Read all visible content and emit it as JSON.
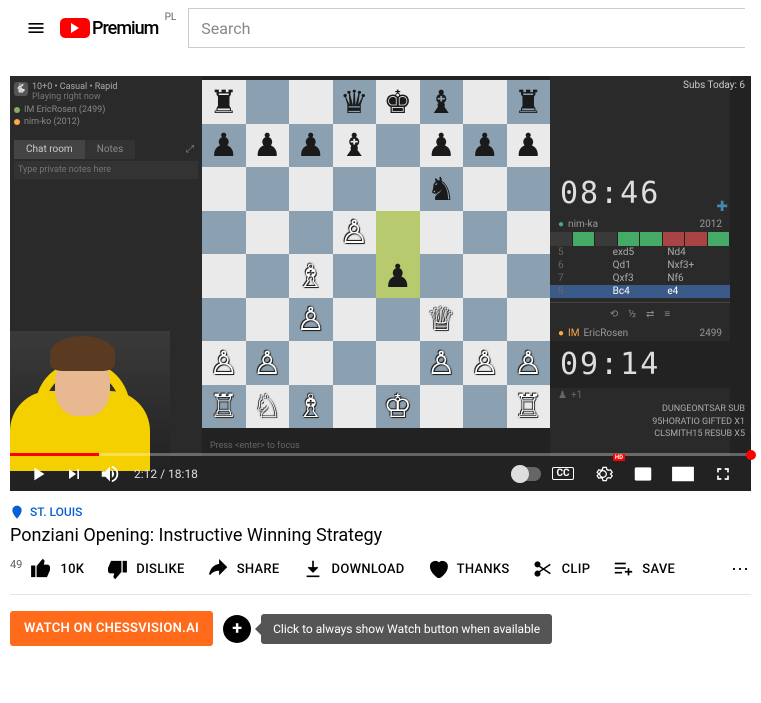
{
  "header": {
    "logo_text": "Premium",
    "country": "PL",
    "search_placeholder": "Search"
  },
  "video": {
    "subs_today": "Subs Today: 6",
    "game_mode": "10+0 • Casual • Rapid",
    "game_status": "Playing right now",
    "players": {
      "top": {
        "name": "IM EricRosen (2499)",
        "color": "#8a6"
      },
      "bottom": {
        "name": "nim-ko (2012)",
        "color": "#fa4"
      }
    },
    "tabs": {
      "chat": "Chat room",
      "notes": "Notes"
    },
    "notes_placeholder": "Type private notes here",
    "clock_top": "08:46",
    "clock_bottom": "09:14",
    "opponent": {
      "name": "nim-ka",
      "rating": "2012"
    },
    "self": {
      "title": "IM",
      "name": "EricRosen",
      "rating": "2499"
    },
    "moves": [
      {
        "n": "5",
        "w": "exd5",
        "b": "Nd4"
      },
      {
        "n": "6",
        "w": "Qd1",
        "b": "Nxf3+"
      },
      {
        "n": "7",
        "w": "Qxf3",
        "b": "Nf6"
      },
      {
        "n": "8",
        "w": "Bc4",
        "b": "e4",
        "cur": true
      }
    ],
    "nav": {
      "back": "½",
      "flip": "⇄"
    },
    "sub_events": [
      "DUNGEONTSAR  SUB",
      "95HORATIO  GIFTED X1",
      "CLSMITH15  RESUB X5"
    ],
    "time_current": "2:12",
    "time_total": "18:18",
    "press_enter": "Press <enter> to focus"
  },
  "meta": {
    "location": "ST. LOUIS",
    "title": "Ponziani Opening: Instructive Winning Strategy",
    "rank": "49",
    "like_count": "10K",
    "actions": {
      "dislike": "DISLIKE",
      "share": "SHARE",
      "download": "DOWNLOAD",
      "thanks": "THANKS",
      "clip": "CLIP",
      "save": "SAVE"
    }
  },
  "ext": {
    "button": "WATCH ON CHESSVISION.AI",
    "tooltip": "Click to always show Watch button when available"
  },
  "board": [
    [
      "r",
      "",
      "",
      "q",
      "k",
      "b",
      "",
      "r"
    ],
    [
      "p",
      "p",
      "p",
      "b",
      "",
      "p",
      "p",
      "p"
    ],
    [
      "",
      "",
      "",
      "",
      "",
      "n",
      "",
      ""
    ],
    [
      "",
      "",
      "",
      "P",
      "HL",
      "",
      "",
      ""
    ],
    [
      "",
      "",
      "B",
      "",
      "HLp",
      "",
      "",
      ""
    ],
    [
      "",
      "",
      "P",
      "",
      "",
      "Q",
      "",
      ""
    ],
    [
      "P",
      "P",
      "",
      "",
      "",
      "P",
      "P",
      "P"
    ],
    [
      "R",
      "N",
      "B",
      "",
      "K",
      "",
      "",
      "R"
    ]
  ]
}
